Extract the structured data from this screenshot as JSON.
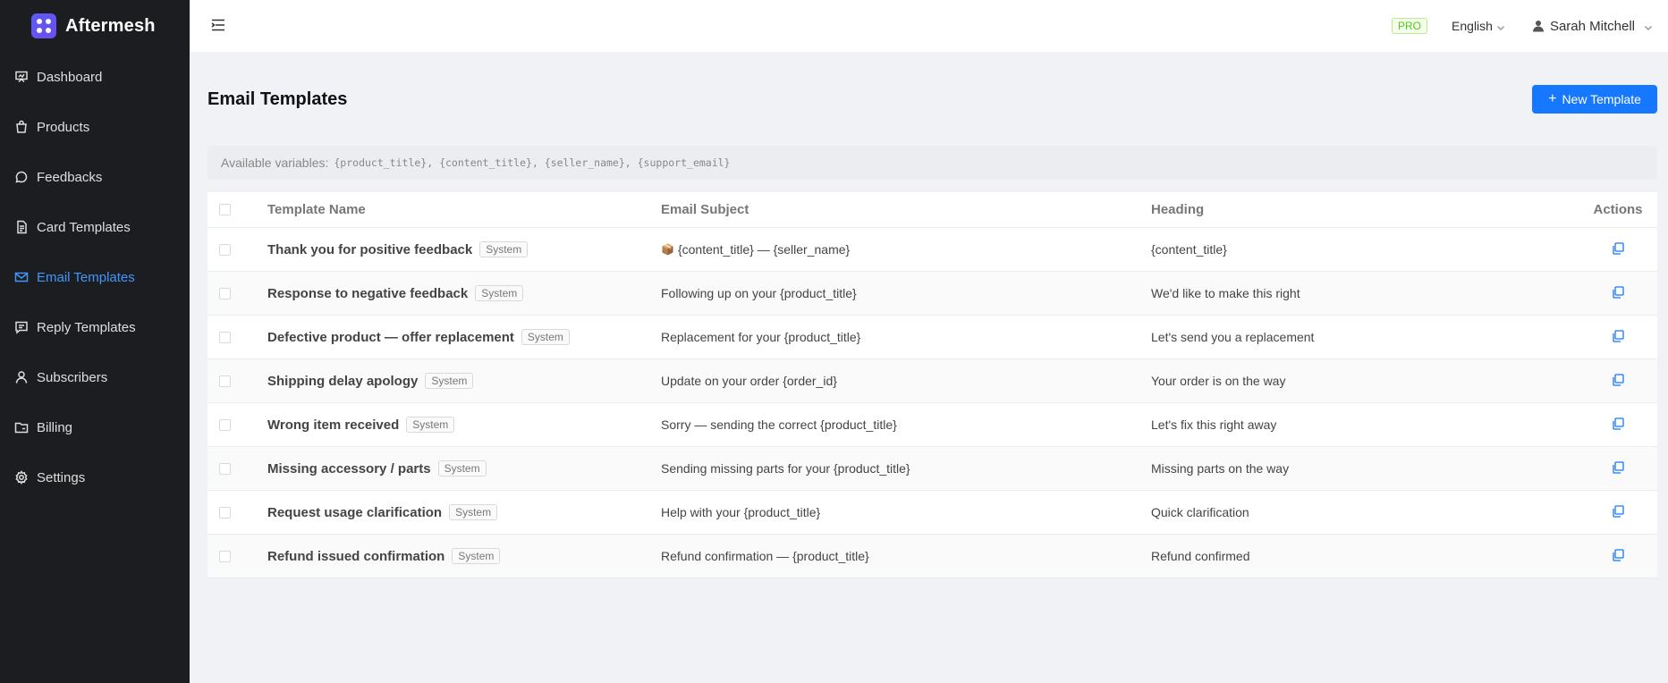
{
  "brand": {
    "name": "Aftermesh"
  },
  "sidebar": {
    "items": [
      {
        "label": "Dashboard",
        "icon": "dashboard-icon"
      },
      {
        "label": "Products",
        "icon": "shopping-bag-icon"
      },
      {
        "label": "Feedbacks",
        "icon": "chat-bubble-icon"
      },
      {
        "label": "Card Templates",
        "icon": "document-icon"
      },
      {
        "label": "Email Templates",
        "icon": "mail-icon",
        "active": true
      },
      {
        "label": "Reply Templates",
        "icon": "message-icon"
      },
      {
        "label": "Subscribers",
        "icon": "user-icon"
      },
      {
        "label": "Billing",
        "icon": "folder-icon"
      },
      {
        "label": "Settings",
        "icon": "gear-icon"
      }
    ]
  },
  "header": {
    "pro_badge": "PRO",
    "language": "English",
    "user_name": "Sarah Mitchell"
  },
  "page": {
    "title": "Email Templates",
    "new_button": "New Template",
    "vars_label": "Available variables:",
    "vars_list": "{product_title}, {content_title}, {seller_name}, {support_email}"
  },
  "table": {
    "columns": {
      "name": "Template Name",
      "subject": "Email Subject",
      "heading": "Heading",
      "actions": "Actions"
    },
    "rows": [
      {
        "name": "Thank you for positive feedback",
        "tag": "System",
        "subject": "{content_title} — {seller_name}",
        "emoji": "📦",
        "heading": "{content_title}"
      },
      {
        "name": "Response to negative feedback",
        "tag": "System",
        "subject": "Following up on your {product_title}",
        "heading": "We'd like to make this right"
      },
      {
        "name": "Defective product — offer replacement",
        "tag": "System",
        "subject": "Replacement for your {product_title}",
        "heading": "Let's send you a replacement"
      },
      {
        "name": "Shipping delay apology",
        "tag": "System",
        "subject": "Update on your order {order_id}",
        "heading": "Your order is on the way"
      },
      {
        "name": "Wrong item received",
        "tag": "System",
        "subject": "Sorry — sending the correct {product_title}",
        "heading": "Let's fix this right away"
      },
      {
        "name": "Missing accessory / parts",
        "tag": "System",
        "subject": "Sending missing parts for your {product_title}",
        "heading": "Missing parts on the way"
      },
      {
        "name": "Request usage clarification",
        "tag": "System",
        "subject": "Help with your {product_title}",
        "heading": "Quick clarification"
      },
      {
        "name": "Refund issued confirmation",
        "tag": "System",
        "subject": "Refund confirmation — {product_title}",
        "heading": "Refund confirmed"
      }
    ]
  },
  "colors": {
    "accent": "#1677ff",
    "sidebar_bg": "#1c1d20",
    "active_nav": "#4096ff"
  }
}
